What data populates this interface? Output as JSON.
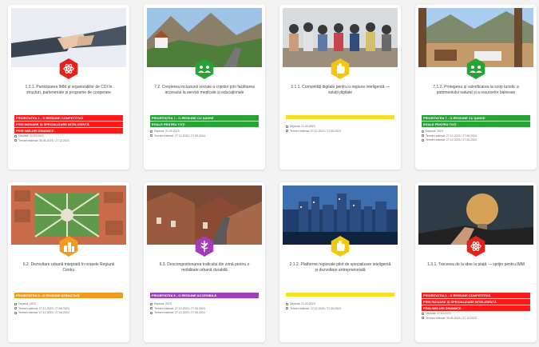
{
  "cards": [
    {
      "title": "1.2.1. Participarea IMM și organizațiilor de CDI în structuri, parteneriate și programe de cooperare",
      "tag_color": "#ff1a1a",
      "tags": [
        "PRIORITATEA 1 - O REGIUNE COMPETITIVĂ",
        "PRIN INOVARE ȘI SPECIALIZARE INTELIGENTĂ",
        "PRIN IMM-URI DINAMICE"
      ],
      "meta": [
        "Depusă: 21.03.2023",
        "Termen estimat: 30.06.2023 / 27.12.2023"
      ],
      "icon": "atom-icon",
      "hex_color": "#e3231b",
      "image": "handshake"
    },
    {
      "title": "7.2. Creșterea incluziunii sociale a copiilor prin facilitarea accesului la servicii medicale și educaționale",
      "tag_color": "#27a335",
      "tags": [
        "PRIORITATEA 7 - O REGIUNE CU ȘANSE",
        "EGALE PENTRU TOȚI"
      ],
      "meta": [
        "Depusă: 21.03.2023",
        "Termen estimat: 27.12.2023 / 27.06.2024"
      ],
      "icon": "people-icon",
      "hex_color": "#27a335",
      "image": "mountains"
    },
    {
      "title": "2.1.1. Comunități digitale pentru o regiune inteligentă — soluții digitale",
      "tag_color": "#f5e024",
      "tags": [
        ""
      ],
      "meta": [
        "Depusă: 21.03.2023",
        "Termen estimat: 27.12.2023 / 27.06.2024"
      ],
      "icon": "hand-icon",
      "hex_color": "#f2c714",
      "image": "people"
    },
    {
      "title": "7.1.2. Protejarea și valorificarea la scop turistic a patrimoniului natural și a resurselor balneare",
      "tag_color": "#27a335",
      "tags": [
        "PRIORITATEA 7 - O REGIUNE CU ȘANSE",
        "EGALE PENTRU TOȚI"
      ],
      "meta": [
        "Depusă: 2023",
        "Termen estimat: 27.12.2023 / 27.06.2024",
        "Termen estimat: 27.12.2023 / 27.06.2024"
      ],
      "icon": "people-icon",
      "hex_color": "#27a335",
      "image": "terrace"
    },
    {
      "title": "6.2. Dezvoltare urbană integrată în orașele Regiunii Centru",
      "tag_color": "#f39a1e",
      "tags": [
        "PRIORITATEA 6 - O REGIUNE ATRACTIVĂ"
      ],
      "meta": [
        "Depusă: 2023",
        "Termen estimat: 27.12.2023 / 27.06.2024",
        "Termen estimat: 27.12.2023 / 27.06.2024"
      ],
      "icon": "city-icon",
      "hex_color": "#f39a1e",
      "image": "aerial"
    },
    {
      "title": "6.3. Descongestionarea traficului din zonă pentru o mobilitate urbană durabilă",
      "tag_color": "#a23fb8",
      "tags": [
        "PRIORITATEA 6 - O REGIUNE ACCESIBILĂ"
      ],
      "meta": [
        "Depusă: 2023",
        "Termen estimat: 27.12.2023 / 27.06.2024",
        "Termen estimat: 27.12.2023 / 27.06.2024"
      ],
      "icon": "medical-icon",
      "hex_color": "#a23fb8",
      "image": "rooftops"
    },
    {
      "title": "2.1.2. Platforme regionale pilot de specializare inteligentă și dezvoltare antreprenorială",
      "tag_color": "#f5e024",
      "tags": [
        ""
      ],
      "meta": [
        "Depusă: 21.03.2023",
        "Termen estimat: 27.12.2023 / 27.06.2024"
      ],
      "icon": "hand-icon",
      "hex_color": "#f2c714",
      "image": "city"
    },
    {
      "title": "1.3.1. Trecerea de la idee la piață — sprijin pentru IMM",
      "tag_color": "#ff1a1a",
      "tags": [
        "PRIORITATEA 1 - O REGIUNE COMPETITIVĂ",
        "PRIN INOVARE ȘI SPECIALIZARE INTELIGENTĂ",
        "PRIN IMM-URI DINAMICE"
      ],
      "meta": [
        "Depusă: 21.03.2023",
        "Termen estimat: 30.06.2023 / 27.12.2023"
      ],
      "icon": "atom-icon",
      "hex_color": "#e3231b",
      "image": "bulb"
    }
  ]
}
